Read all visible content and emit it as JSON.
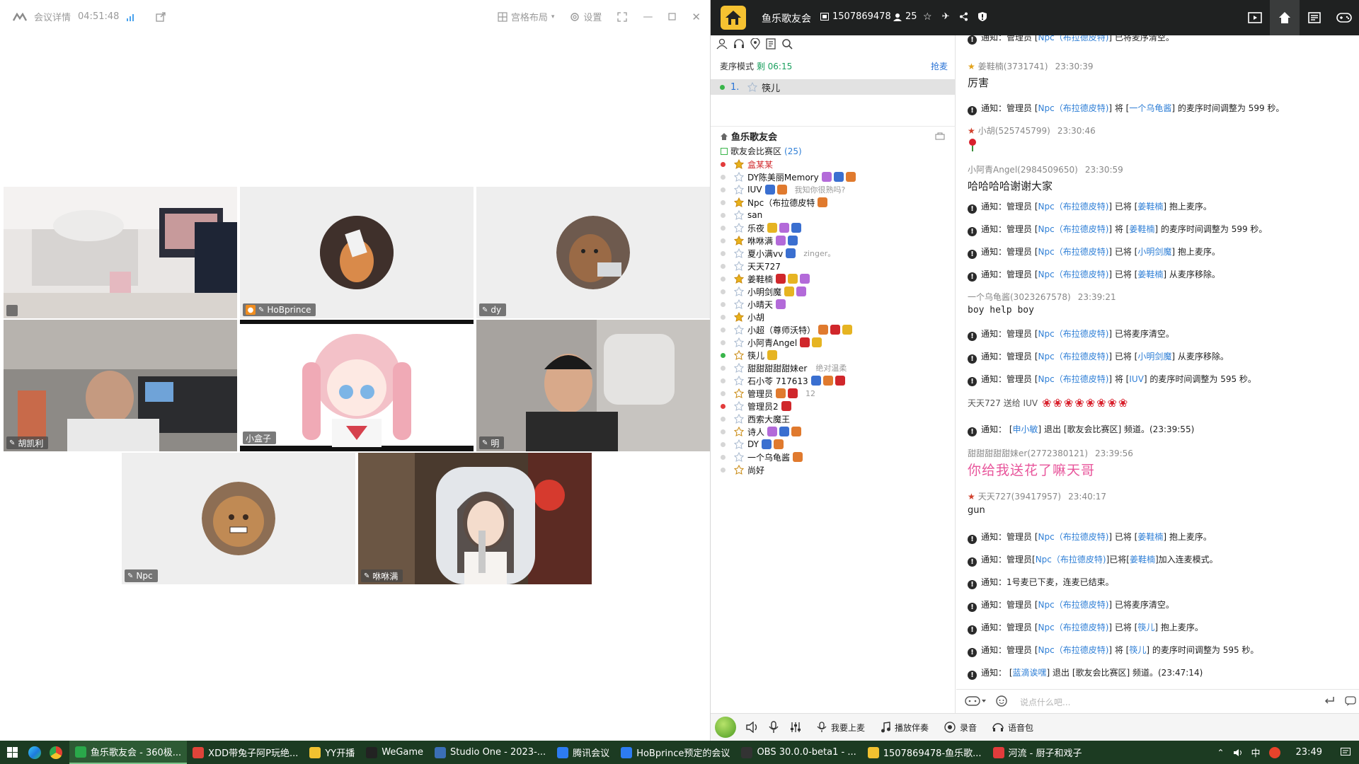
{
  "meeting": {
    "title": "会议详情",
    "timer": "04:51:48",
    "layout_label": "宫格布局",
    "settings_label": "设置",
    "tiles": [
      {
        "name": "",
        "kind": "room"
      },
      {
        "name": "HoBprince",
        "kind": "avatar-cat",
        "host": true
      },
      {
        "name": "dy",
        "kind": "avatar-bear"
      },
      {
        "name": "胡凯利",
        "kind": "room2"
      },
      {
        "name": "小盒子",
        "kind": "anime"
      },
      {
        "name": "明",
        "kind": "person"
      },
      {
        "name": "Npc",
        "kind": "avatar-cookie"
      },
      {
        "name": "咻咻满",
        "kind": "streamer"
      }
    ]
  },
  "yy": {
    "channel_name": "鱼乐歌友会",
    "channel_id": "1507869478",
    "user_count": "25",
    "queue": {
      "mode_label": "麦序模式",
      "remaining": "剩 06:15",
      "grab_label": "抢麦",
      "first": {
        "index": "1.",
        "name": "筷儿"
      }
    },
    "tree": {
      "root": "鱼乐歌友会",
      "sub": "歌友会比赛区",
      "sub_count": "(25)",
      "users": [
        {
          "name": "盒某某",
          "red": true,
          "dot": "red",
          "sig": ""
        },
        {
          "name": "DY陈美丽Memory",
          "sig": ""
        },
        {
          "name": "IUV",
          "sig": "我知你很熟吗?"
        },
        {
          "name": "Npc（布拉德皮特",
          "sig": ""
        },
        {
          "name": "san",
          "sig": ""
        },
        {
          "name": "乐夜",
          "sig": ""
        },
        {
          "name": "咻咻满",
          "sig": ""
        },
        {
          "name": "夏小满vv",
          "sig": "zinger。"
        },
        {
          "name": "天天727",
          "sig": ""
        },
        {
          "name": "姜鞋楠",
          "sig": ""
        },
        {
          "name": "小明剑魔",
          "sig": ""
        },
        {
          "name": "小晴天",
          "sig": ""
        },
        {
          "name": "小胡",
          "sig": ""
        },
        {
          "name": "小超（尊师沃特）",
          "sig": ""
        },
        {
          "name": "小阿青Angel",
          "sig": ""
        },
        {
          "name": "筷儿",
          "dot": "on",
          "sig": ""
        },
        {
          "name": "甜甜甜甜甜妹er",
          "sig": "绝对温柔"
        },
        {
          "name": "石小苓 717613",
          "sig": ""
        },
        {
          "name": "管理员",
          "sig": "12"
        },
        {
          "name": "管理员2",
          "dot": "red",
          "sig": ""
        },
        {
          "name": "西索大魔王",
          "sig": ""
        },
        {
          "name": "诗人",
          "sig": ""
        },
        {
          "name": "DY",
          "sig": ""
        },
        {
          "name": "一个乌龟酱",
          "sig": ""
        },
        {
          "name": "尚好",
          "sig": ""
        }
      ]
    },
    "chat": {
      "m01": {
        "pre": "通知：管理员 [",
        "lnk": "Npc（布拉德皮特)",
        "post": "] 已将麦序清空。"
      },
      "m02_meta": "姜鞋楠(3731741)",
      "m02_time": "23:30:39",
      "m02_body": "厉害",
      "m03": {
        "pre": "通知：管理员 [",
        "lnk": "Npc（布拉德皮特)",
        "mid": "] 将 [",
        "lnk2": "一个乌龟酱",
        "post": "] 的麦序时间调整为 599 秒。"
      },
      "m04_meta": "小胡(525745799)",
      "m04_time": "23:30:46",
      "m05_meta": "小阿青Angel(2984509650)",
      "m05_time": "23:30:59",
      "m05_body": "哈哈哈哈谢谢大家",
      "m06": {
        "pre": "通知：管理员 [",
        "lnk": "Npc（布拉德皮特)",
        "mid": "] 已将 [",
        "lnk2": "姜鞋楠",
        "post": "] 抱上麦序。"
      },
      "m07": {
        "pre": "通知：管理员 [",
        "lnk": "Npc（布拉德皮特)",
        "mid": "] 将 [",
        "lnk2": "姜鞋楠",
        "post": "] 的麦序时间调整为 599 秒。"
      },
      "m08": {
        "pre": "通知：管理员 [",
        "lnk": "Npc（布拉德皮特)",
        "mid": "] 已将 [",
        "lnk2": "小明剑魔",
        "post": "] 抱上麦序。"
      },
      "m09": {
        "pre": "通知：管理员 [",
        "lnk": "Npc（布拉德皮特)",
        "mid": "] 已将 [",
        "lnk2": "姜鞋楠",
        "post": "] 从麦序移除。"
      },
      "m10_meta": "一个乌龟酱(3023267578)",
      "m10_time": "23:39:21",
      "m10_body": "boy help boy",
      "m11": {
        "pre": "通知：管理员 [",
        "lnk": "Npc（布拉德皮特)",
        "post": "] 已将麦序清空。"
      },
      "m12": {
        "pre": "通知：管理员 [",
        "lnk": "Npc（布拉德皮特)",
        "mid": "] 已将 [",
        "lnk2": "小明剑魔",
        "post": "] 从麦序移除。"
      },
      "m13": {
        "pre": "通知：管理员 [",
        "lnk": "Npc（布拉德皮特)",
        "mid": "] 将 [",
        "lnk2": "IUV",
        "post": "] 的麦序时间调整为 595 秒。"
      },
      "m14_text": "天天727 送给 IUV",
      "m15": {
        "pre": "通知： [",
        "lnk": "申小敏",
        "post": "] 退出 [歌友会比赛区] 频道。(23:39:55)"
      },
      "m16_meta": "甜甜甜甜甜妹er(2772380121)",
      "m16_time": "23:39:56",
      "m16_body": "你给我送花了嘛天哥",
      "m17_meta": "天天727(39417957)",
      "m17_time": "23:40:17",
      "m17_body": "gun",
      "m18": {
        "pre": "通知：管理员 [",
        "lnk": "Npc（布拉德皮特)",
        "mid": "] 已将 [",
        "lnk2": "姜鞋楠",
        "post": "] 抱上麦序。"
      },
      "m19": {
        "pre": "通知：管理员[",
        "lnk": "Npc（布拉德皮特)",
        "mid": "]已将[",
        "lnk2": "姜鞋楠",
        "post": "]加入连麦模式。"
      },
      "m20_text": "通知：1号麦已下麦，连麦已结束。",
      "m21": {
        "pre": "通知：管理员 [",
        "lnk": "Npc（布拉德皮特)",
        "post": "] 已将麦序清空。"
      },
      "m22": {
        "pre": "通知：管理员 [",
        "lnk": "Npc（布拉德皮特)",
        "mid": "] 已将 [",
        "lnk2": "筷儿",
        "post": "] 抱上麦序。"
      },
      "m23": {
        "pre": "通知：管理员 [",
        "lnk": "Npc（布拉德皮特)",
        "mid": "] 将 [",
        "lnk2": "筷儿",
        "post": "] 的麦序时间调整为 595 秒。"
      },
      "m24": {
        "pre": "通知： [",
        "lnk": "蓝滴诶嘿",
        "post": "] 退出 [歌友会比赛区] 频道。(23:47:14)"
      },
      "input_placeholder": "说点什么吧..."
    },
    "toolbar": {
      "apply_mic": "我要上麦",
      "accompaniment": "播放伴奏",
      "record": "录音",
      "voice_pack": "语音包"
    }
  },
  "taskbar": {
    "apps": [
      {
        "label": "鱼乐歌友会 - 360极...",
        "color": "#2aa84a"
      },
      {
        "label": "XDD带兔子阿P玩绝...",
        "color": "#e0443a"
      },
      {
        "label": "YY开播",
        "color": "#f2c230"
      },
      {
        "label": "WeGame",
        "color": "#222222"
      },
      {
        "label": "Studio One - 2023-...",
        "color": "#3b6fb6"
      },
      {
        "label": "腾讯会议",
        "color": "#2d7cf2"
      },
      {
        "label": "HoBprince预定的会议",
        "color": "#2d7cf2"
      },
      {
        "label": "OBS 30.0.0-beta1 - ...",
        "color": "#333333"
      },
      {
        "label": "1507869478-鱼乐歌...",
        "color": "#f2c230"
      },
      {
        "label": "河流 - 厨子和戏子",
        "color": "#e23c3c"
      }
    ],
    "ime": "中",
    "clock": "23:49"
  }
}
